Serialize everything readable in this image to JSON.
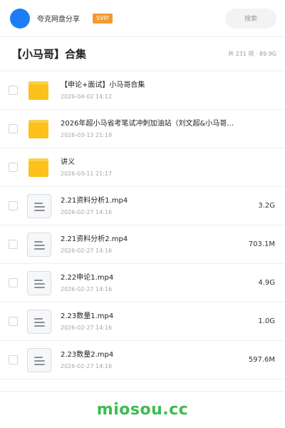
{
  "header": {
    "app_name": "夸克网盘分享",
    "badge": "SVIP",
    "search_label": "搜索"
  },
  "folder": {
    "title": "【小马哥】合集",
    "summary": "共 231 项 · 89.9G"
  },
  "files": [
    {
      "type": "folder",
      "icon": "folder-icon",
      "name": "【申论+面试】小马哥合集",
      "date": "2026-04-02 14:12",
      "size": ""
    },
    {
      "type": "folder",
      "icon": "folder-icon",
      "name": "2026年超小马省考笔试冲刺加油站（刘文超&小马哥…",
      "date": "2026-03-13 21:18",
      "size": ""
    },
    {
      "type": "folder",
      "icon": "folder-icon",
      "name": "讲义",
      "date": "2026-03-11 21:17",
      "size": ""
    },
    {
      "type": "file",
      "icon": "file-icon",
      "name": "2.21资料分析1.mp4",
      "date": "2026-02-27 14:16",
      "size": "3.2G"
    },
    {
      "type": "file",
      "icon": "file-icon",
      "name": "2.21资料分析2.mp4",
      "date": "2026-02-27 14:16",
      "size": "703.1M"
    },
    {
      "type": "file",
      "icon": "file-icon",
      "name": "2.22申论1.mp4",
      "date": "2026-02-27 14:16",
      "size": "4.9G"
    },
    {
      "type": "file",
      "icon": "file-icon",
      "name": "2.23数量1.mp4",
      "date": "2026-02-27 14:16",
      "size": "1.0G"
    },
    {
      "type": "file",
      "icon": "file-icon",
      "name": "2.23数量2.mp4",
      "date": "2026-02-27 14:16",
      "size": "597.6M"
    }
  ],
  "footer": {
    "watermark": "miosou.cc"
  },
  "colors": {
    "brand_blue": "#1f7cf8",
    "svip_orange": "#f59a2a",
    "folder_yellow": "#fcc21b",
    "watermark_green": "#3cbc4e"
  }
}
